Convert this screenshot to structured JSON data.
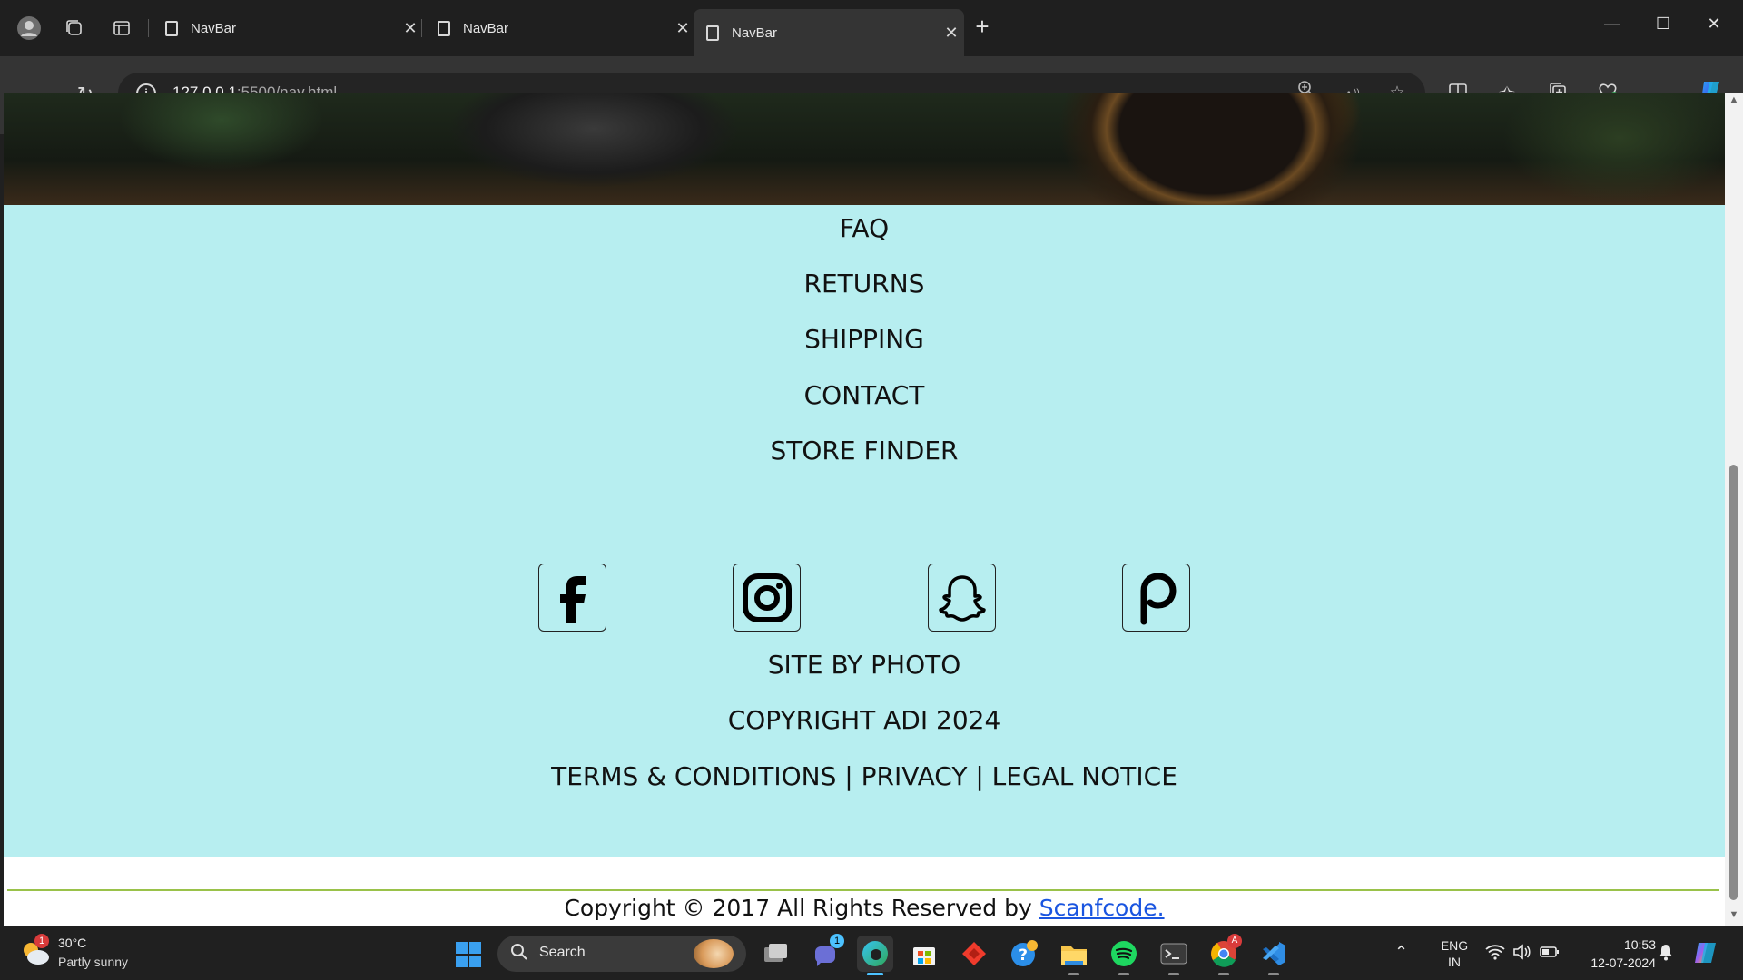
{
  "browser": {
    "tabs": [
      {
        "label": "NavBar",
        "active": false
      },
      {
        "label": "NavBar",
        "active": false
      },
      {
        "label": "NavBar",
        "active": true
      }
    ],
    "url_host": "127.0.0.1",
    "url_rest": ":5500/nav.html"
  },
  "footer": {
    "links": [
      "FAQ",
      "RETURNS",
      "SHIPPING",
      "CONTACT",
      "STORE FINDER"
    ],
    "socials": [
      "facebook-icon",
      "instagram-icon",
      "snapchat-icon",
      "pinterest-icon"
    ],
    "site_by": "SITE BY PHOTO",
    "copyright_line": "COPYRIGHT ADI 2024",
    "legal": "TERMS & CONDITIONS | PRIVACY | LEGAL NOTICE",
    "bottom_text": "Copyright © 2017 All Rights Reserved by",
    "bottom_link": "Scanfcode.",
    "background_color": "#b7eef0",
    "line_color": "#9ac24a",
    "link_color": "#1a55e0"
  },
  "taskbar": {
    "weather_temp": "30°C",
    "weather_desc": "Partly sunny",
    "weather_badge": "1",
    "search_label": "Search",
    "teams_badge": "1",
    "chrome_badge": "A",
    "lang_line1": "ENG",
    "lang_line2": "IN",
    "time": "10:53",
    "date": "12-07-2024",
    "accent": "#4cc2ff"
  }
}
